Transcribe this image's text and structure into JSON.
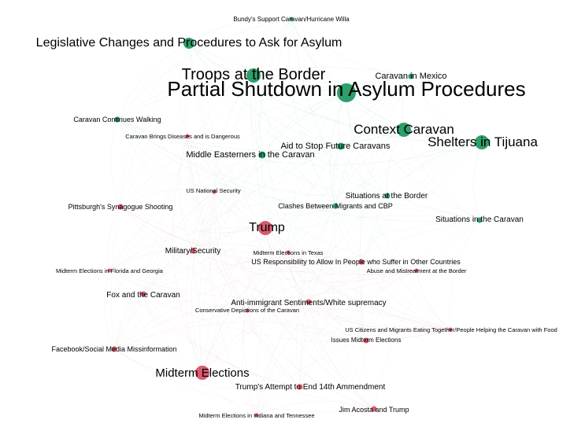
{
  "colors": {
    "green": "#2e9e6b",
    "red": "#d95a6e",
    "green_edge": "#52b88a",
    "red_edge": "#e58a98"
  },
  "nodes": [
    {
      "id": "bundy",
      "label": "Bundy's Support Caravan/Hurricane Willa",
      "group": "green",
      "level": 1
    },
    {
      "id": "legislative",
      "label": "Legislative Changes and Procedures to Ask for Asylum",
      "group": "green",
      "level": 4
    },
    {
      "id": "troops",
      "label": "Troops at the Border",
      "group": "green",
      "level": 5
    },
    {
      "id": "mexico",
      "label": "Caravan in Mexico",
      "group": "green",
      "level": 2
    },
    {
      "id": "shutdown",
      "label": "Partial Shutdown in Asylum Procedures",
      "group": "green",
      "level": 7
    },
    {
      "id": "walking",
      "label": "Caravan Continues Walking",
      "group": "green",
      "level": 2
    },
    {
      "id": "diseases",
      "label": "Caravan Brings Diseases and is Dangerous",
      "group": "red",
      "level": 1
    },
    {
      "id": "context",
      "label": "Context Caravan",
      "group": "green",
      "level": 5
    },
    {
      "id": "shelters",
      "label": "Shelters in Tijuana",
      "group": "green",
      "level": 5
    },
    {
      "id": "aid",
      "label": "Aid to Stop Future Caravans",
      "group": "green",
      "level": 3
    },
    {
      "id": "middleeast",
      "label": "Middle Easterners in the Caravan",
      "group": "green",
      "level": 3
    },
    {
      "id": "nationalsec",
      "label": "US National Security",
      "group": "red",
      "level": 1
    },
    {
      "id": "sitborder",
      "label": "Situations at the Border",
      "group": "green",
      "level": 2
    },
    {
      "id": "pittsburgh",
      "label": "Pittsburgh's Synagogue Shooting",
      "group": "red",
      "level": 2
    },
    {
      "id": "clashes",
      "label": "Clashes Between Migrants and CBP",
      "group": "green",
      "level": 2
    },
    {
      "id": "sitcaravan",
      "label": "Situations in the Caravan",
      "group": "green",
      "level": 2
    },
    {
      "id": "trump",
      "label": "Trump",
      "group": "red",
      "level": 5
    },
    {
      "id": "military",
      "label": "Military/Security",
      "group": "red",
      "level": 2
    },
    {
      "id": "texas",
      "label": "Midterm Elections in Texas",
      "group": "red",
      "level": 1
    },
    {
      "id": "responsibility",
      "label": "US Responsibility to Allow In People who Suffer in Other Countries",
      "group": "red",
      "level": 2
    },
    {
      "id": "florida",
      "label": "Midterm Elections in Florida and Georgia",
      "group": "red",
      "level": 1
    },
    {
      "id": "abuse",
      "label": "Abuse and Mistreatment at the Border",
      "group": "red",
      "level": 1
    },
    {
      "id": "fox",
      "label": "Fox and the Caravan",
      "group": "red",
      "level": 2
    },
    {
      "id": "antiimm",
      "label": "Anti-immigrant Sentiments/White supremacy",
      "group": "red",
      "level": 2
    },
    {
      "id": "conservative",
      "label": "Conservative Depictions of the Caravan",
      "group": "red",
      "level": 1
    },
    {
      "id": "citizens",
      "label": "US Citizens and Migrants Eating Together/People Helping the Caravan with Food",
      "group": "red",
      "level": 1
    },
    {
      "id": "issues",
      "label": "Issues Midterm Elections",
      "group": "red",
      "level": 2
    },
    {
      "id": "facebook",
      "label": "Facebook/Social Media Missinformation",
      "group": "red",
      "level": 2
    },
    {
      "id": "midterm",
      "label": "Midterm Elections",
      "group": "red",
      "level": 5
    },
    {
      "id": "14th",
      "label": "Trump's Attempt to End 14th Ammendment",
      "group": "red",
      "level": 2
    },
    {
      "id": "acosta",
      "label": "Jim Acosta and Trump",
      "group": "red",
      "level": 2
    },
    {
      "id": "indiana",
      "label": "Midterm Elections in Indiana and Tennessee",
      "group": "red",
      "level": 1
    }
  ]
}
